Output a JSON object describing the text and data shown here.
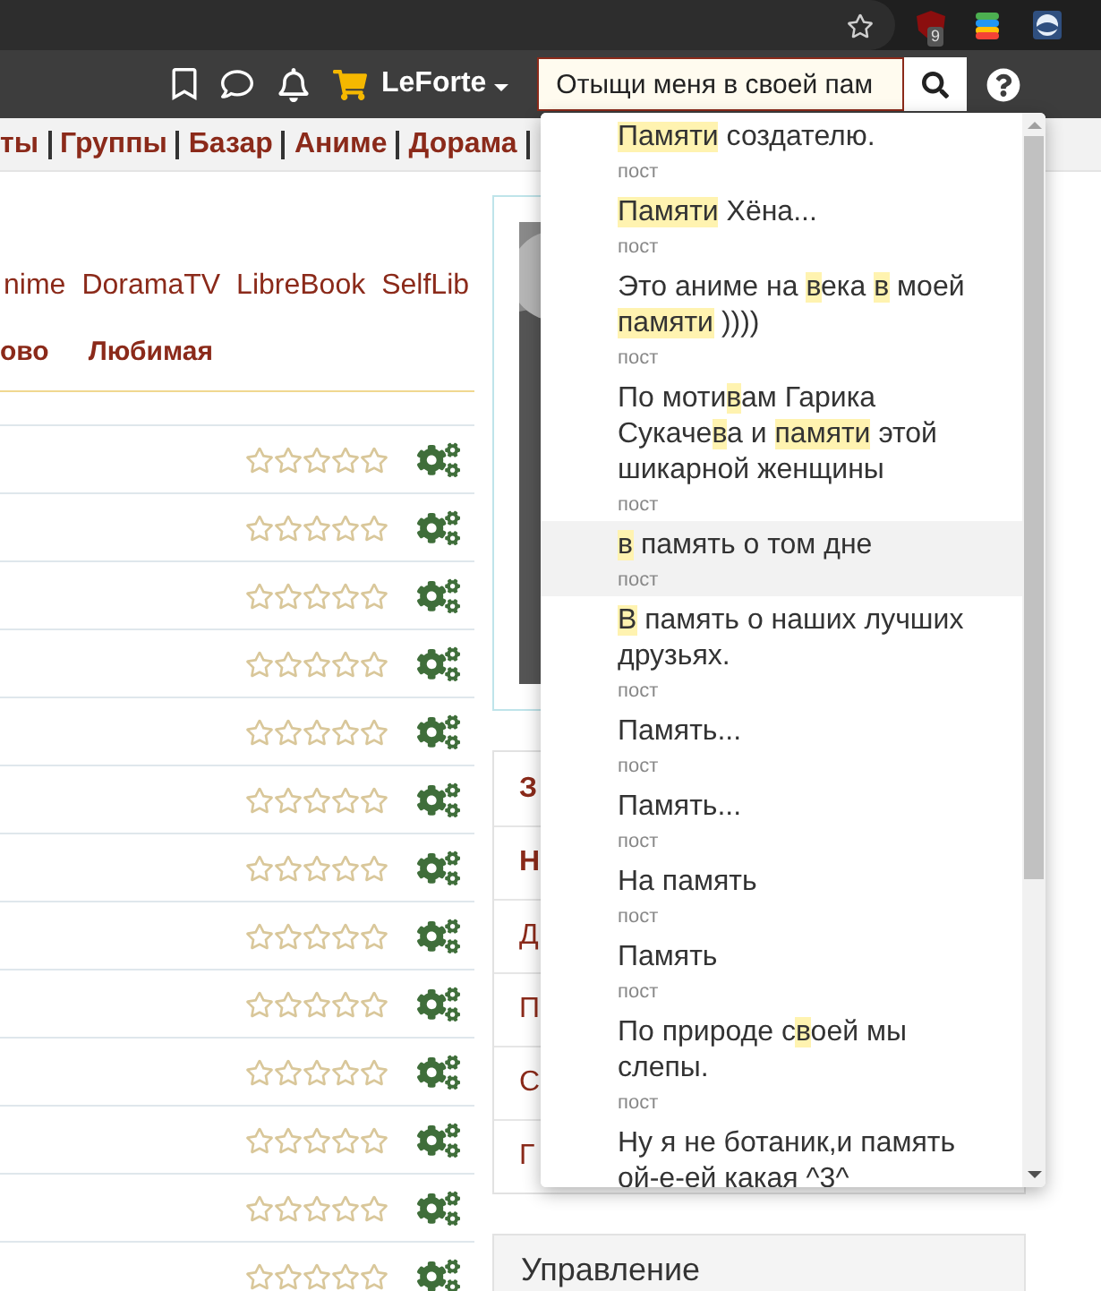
{
  "browser": {
    "extension_badge": "9"
  },
  "header": {
    "username": "LeForte",
    "search": {
      "value": "Отыщи меня в своей пам"
    }
  },
  "nav": {
    "links": [
      "ты",
      "Группы",
      "Базар",
      "Аниме",
      "Дорама"
    ]
  },
  "sites": [
    "nime",
    "DoramaTV",
    "LibreBook",
    "SelfLib"
  ],
  "tabs": [
    {
      "label": "ово",
      "selected": false
    },
    {
      "label": "Любимая",
      "selected": false
    }
  ],
  "rows": [
    {
      "stars": 0
    },
    {
      "stars": 0
    },
    {
      "stars": 0
    },
    {
      "stars": 0
    },
    {
      "stars": 0
    },
    {
      "stars": 0
    },
    {
      "stars": 0
    },
    {
      "stars": 0
    },
    {
      "stars": 0
    },
    {
      "stars": 0
    },
    {
      "stars": 0
    },
    {
      "stars": 0
    },
    {
      "stars": 0
    }
  ],
  "side_menu": [
    {
      "label": "З",
      "bold": true
    },
    {
      "label": "Н",
      "bold": true
    },
    {
      "label": "Д",
      "bold": false
    },
    {
      "label": "П",
      "bold": false
    },
    {
      "label": "С",
      "bold": false
    },
    {
      "label": "Г",
      "bold": false
    }
  ],
  "manage_panel": {
    "title": "Управление"
  },
  "suggestions": [
    {
      "selected": false,
      "type": "пост",
      "segments": [
        {
          "text": "Памяти",
          "highlight": true
        },
        {
          "text": " создателю.",
          "highlight": false
        }
      ]
    },
    {
      "selected": false,
      "type": "пост",
      "segments": [
        {
          "text": "Памяти",
          "highlight": true
        },
        {
          "text": " Хёна...",
          "highlight": false
        }
      ]
    },
    {
      "selected": false,
      "type": "пост",
      "segments": [
        {
          "text": "Это аниме на ",
          "highlight": false
        },
        {
          "text": "в",
          "highlight": true
        },
        {
          "text": "ека ",
          "highlight": false
        },
        {
          "text": "в",
          "highlight": true
        },
        {
          "text": " моей ",
          "highlight": false
        },
        {
          "text": "памяти",
          "highlight": true
        },
        {
          "text": " ))))",
          "highlight": false
        }
      ]
    },
    {
      "selected": false,
      "type": "пост",
      "segments": [
        {
          "text": "По моти",
          "highlight": false
        },
        {
          "text": "в",
          "highlight": true
        },
        {
          "text": "ам Гарика Сукаче",
          "highlight": false
        },
        {
          "text": "в",
          "highlight": true
        },
        {
          "text": "а и ",
          "highlight": false
        },
        {
          "text": "памяти",
          "highlight": true
        },
        {
          "text": " этой шикарной женщины",
          "highlight": false
        }
      ]
    },
    {
      "selected": true,
      "type": "пост",
      "segments": [
        {
          "text": "в",
          "highlight": true
        },
        {
          "text": " память о том дне",
          "highlight": false
        }
      ]
    },
    {
      "selected": false,
      "type": "пост",
      "segments": [
        {
          "text": "В",
          "highlight": true
        },
        {
          "text": " память о наших лучших друзьях.",
          "highlight": false
        }
      ]
    },
    {
      "selected": false,
      "type": "пост",
      "segments": [
        {
          "text": "Память...",
          "highlight": false
        }
      ]
    },
    {
      "selected": false,
      "type": "пост",
      "segments": [
        {
          "text": "Память...",
          "highlight": false
        }
      ]
    },
    {
      "selected": false,
      "type": "пост",
      "segments": [
        {
          "text": "На память",
          "highlight": false
        }
      ]
    },
    {
      "selected": false,
      "type": "пост",
      "segments": [
        {
          "text": "Память",
          "highlight": false
        }
      ]
    },
    {
      "selected": false,
      "type": "пост",
      "segments": [
        {
          "text": "По природе с",
          "highlight": false
        },
        {
          "text": "в",
          "highlight": true
        },
        {
          "text": "оей мы слепы.",
          "highlight": false
        }
      ]
    },
    {
      "selected": false,
      "segments": [
        {
          "text": "Ну я не ботаник,и память ой-е-ей какая ^3^",
          "highlight": false
        }
      ]
    }
  ]
}
